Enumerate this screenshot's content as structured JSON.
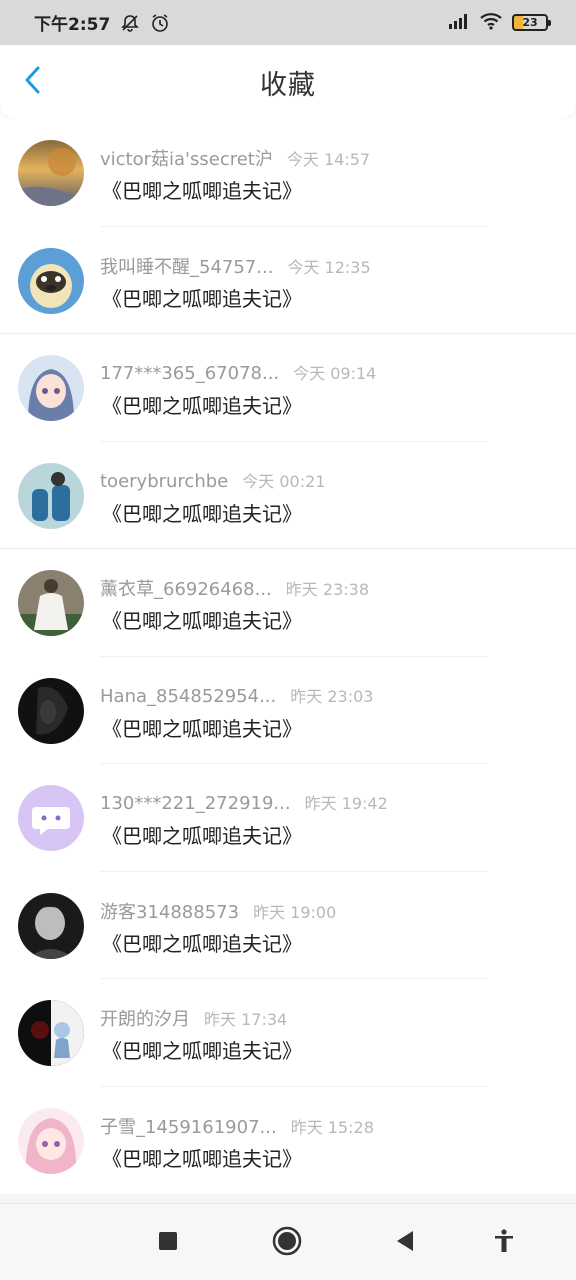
{
  "status_bar": {
    "time": "下午2:57",
    "battery": "23",
    "icons": [
      "mute-icon",
      "alarm-icon",
      "signal-icon",
      "wifi-icon",
      "battery-icon"
    ]
  },
  "header": {
    "title": "收藏",
    "back_icon": "chevron-left-icon",
    "accent_color": "#1e9be8"
  },
  "items": [
    {
      "name": "victor菇ia'ssecret沪",
      "time": "今天 14:57",
      "title": "《巴唧之呱唧追夫记》",
      "avatar": "autumn-road"
    },
    {
      "name": "我叫睡不醒_54757...",
      "time": "今天 12:35",
      "title": "《巴唧之呱唧追夫记》",
      "avatar": "pug"
    },
    {
      "name": "177***365_67078...",
      "time": "今天 09:14",
      "title": "《巴唧之呱唧追夫记》",
      "avatar": "anime-girl-blue"
    },
    {
      "name": "toerybrurchbe",
      "time": "今天 00:21",
      "title": "《巴唧之呱唧追夫记》",
      "avatar": "blue-outfit"
    },
    {
      "name": "薰衣草_66926468...",
      "time": "昨天 23:38",
      "title": "《巴唧之呱唧追夫记》",
      "avatar": "white-dress"
    },
    {
      "name": "Hana_854852954...",
      "time": "昨天 23:03",
      "title": "《巴唧之呱唧追夫记》",
      "avatar": "dark-portrait"
    },
    {
      "name": "130***221_272919...",
      "time": "昨天 19:42",
      "title": "《巴唧之呱唧追夫记》",
      "avatar": "chat-bubble"
    },
    {
      "name": "游客314888573",
      "time": "昨天 19:00",
      "title": "《巴唧之呱唧追夫记》",
      "avatar": "bw-man"
    },
    {
      "name": "开朗的汐月",
      "time": "昨天 17:34",
      "title": "《巴唧之呱唧追夫记》",
      "avatar": "dark-anime"
    },
    {
      "name": "子雪_1459161907...",
      "time": "昨天 15:28",
      "title": "《巴唧之呱唧追夫记》",
      "avatar": "pink-anime"
    }
  ],
  "nav_bar": {
    "buttons": [
      "recent-apps-icon",
      "home-icon",
      "back-triangle-icon",
      "accessibility-icon"
    ]
  }
}
